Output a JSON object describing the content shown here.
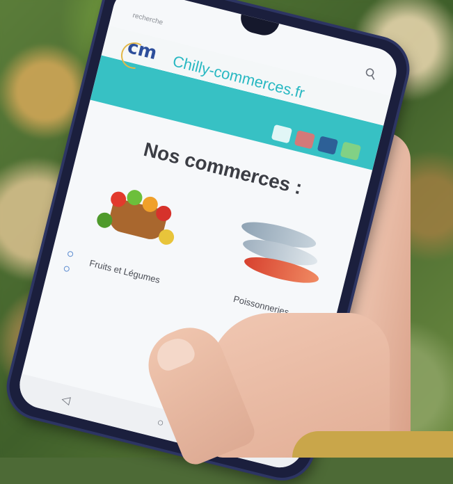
{
  "status_bar": {
    "left": "",
    "right": ""
  },
  "url_bar": {
    "text": "recherche"
  },
  "banner": {
    "logo_text": "cm",
    "site_title": "Chilly-commerces.fr"
  },
  "main": {
    "heading": "Nos commerces :",
    "categories": [
      {
        "label": "Fruits et Légumes",
        "icon": "fruit-basket-image"
      },
      {
        "label": "Poissonneries",
        "icon": "fish-image"
      }
    ]
  },
  "nav": {
    "back": "◁",
    "home": "○",
    "recent": "□"
  },
  "colors": {
    "banner_teal": "#37c1c4",
    "logo_blue": "#2d4e9b",
    "phone_frame": "#1b1f3d"
  }
}
